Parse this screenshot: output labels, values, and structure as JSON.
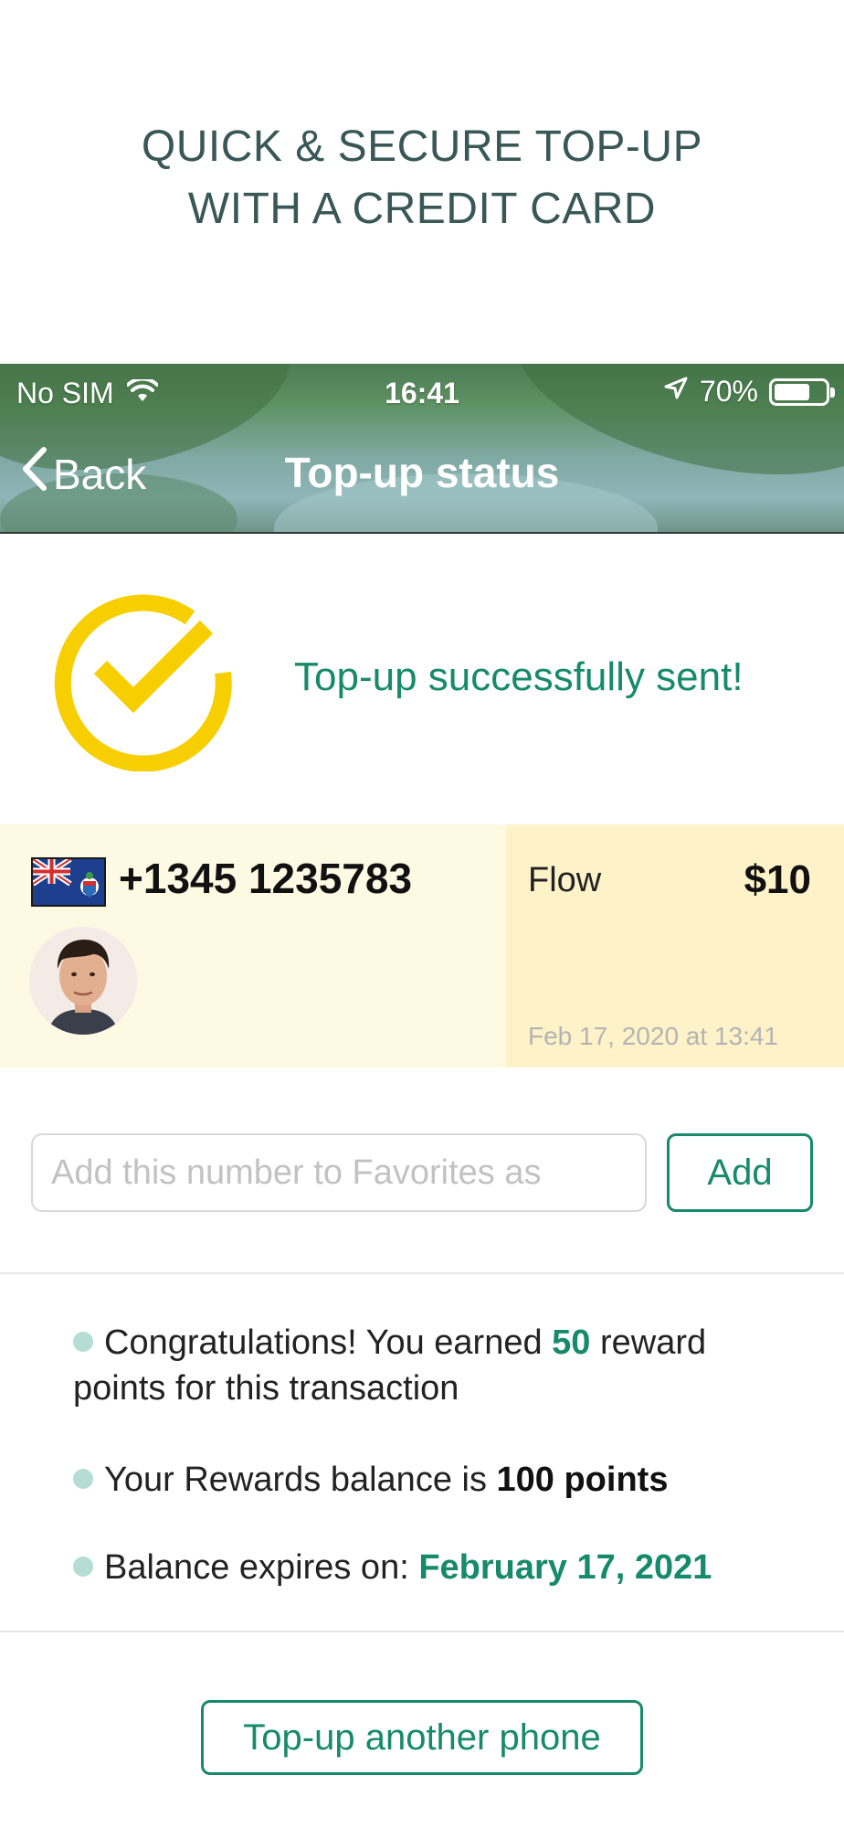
{
  "promo": {
    "line1": "QUICK & SECURE TOP-UP",
    "line2": "WITH A CREDIT CARD"
  },
  "status_bar": {
    "carrier": "No SIM",
    "time": "16:41",
    "battery": "70%",
    "battery_level": 0.7
  },
  "nav": {
    "back_label": "Back",
    "title": "Top-up status"
  },
  "success": {
    "message": "Top-up successfully sent!",
    "icon_color": "#f7cf00"
  },
  "transaction": {
    "phone": "+1345 1235783",
    "operator": "Flow",
    "amount": "$10",
    "date": "Feb 17, 2020 at 13:41"
  },
  "favorites": {
    "placeholder": "Add this number to Favorites as",
    "add_label": "Add"
  },
  "rewards": {
    "line1_pre": "Congratulations! You earned ",
    "line1_points": "50",
    "line1_post": " reward points for this transaction",
    "line2_pre": "Your Rewards balance is ",
    "line2_value": "100 points",
    "line3_pre": "Balance expires on: ",
    "line3_value": "February 17, 2021"
  },
  "actions": {
    "another_label": "Top-up another phone"
  },
  "colors": {
    "accent": "#168a6a",
    "promo_text": "#3a5757",
    "card_left_bg": "#fef9e3",
    "card_right_bg": "#fdf2c8"
  }
}
